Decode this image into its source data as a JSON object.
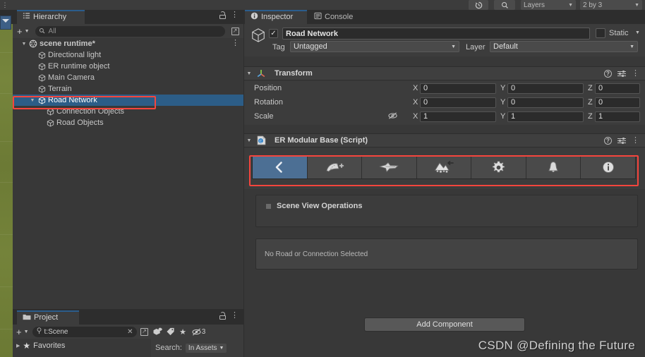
{
  "topbar": {
    "history_icon": "history-icon",
    "search_icon": "search-icon",
    "layers_label": "Layers",
    "layout_label": "2 by 3"
  },
  "hierarchy": {
    "tab_label": "Hierarchy",
    "tab_icon": "hierarchy-icon",
    "lock_icon": "lock-open-icon",
    "menu_icon": "kebab-menu-icon",
    "create_label": "+",
    "search_placeholder": "All",
    "search_icon": "search-icon",
    "expand_icon": "expand-window-icon",
    "items": [
      {
        "label": "scene runtime*",
        "depth": 0,
        "twisty": "▼",
        "icon": "unity-scene-icon",
        "selected": false,
        "kebab": true
      },
      {
        "label": "Directional light",
        "depth": 1,
        "twisty": "",
        "icon": "gameobject-cube-icon",
        "selected": false,
        "kebab": false
      },
      {
        "label": "ER runtime object",
        "depth": 1,
        "twisty": "",
        "icon": "gameobject-cube-icon",
        "selected": false,
        "kebab": false
      },
      {
        "label": "Main Camera",
        "depth": 1,
        "twisty": "",
        "icon": "gameobject-cube-icon",
        "selected": false,
        "kebab": false
      },
      {
        "label": "Terrain",
        "depth": 1,
        "twisty": "",
        "icon": "gameobject-cube-icon",
        "selected": false,
        "kebab": false
      },
      {
        "label": "Road Network",
        "depth": 1,
        "twisty": "▼",
        "icon": "gameobject-cube-icon",
        "selected": true,
        "kebab": false
      },
      {
        "label": "Connection Objects",
        "depth": 2,
        "twisty": "",
        "icon": "gameobject-cube-icon",
        "selected": false,
        "kebab": false
      },
      {
        "label": "Road Objects",
        "depth": 2,
        "twisty": "",
        "icon": "gameobject-cube-icon",
        "selected": false,
        "kebab": false
      }
    ]
  },
  "project": {
    "tab_label": "Project",
    "tab_icon": "folder-icon",
    "lock_icon": "lock-open-icon",
    "menu_icon": "kebab-menu-icon",
    "create_label": "+",
    "search_value": "t:Scene",
    "clear_icon": "clear-x-icon",
    "expand_icon": "expand-window-icon",
    "filter_type_icon": "filter-by-type-icon",
    "filter_label_icon": "filter-by-label-icon",
    "favorite_icon": "star-icon",
    "hidden_packages_icon": "hidden-packages-icon",
    "hidden_packages_count": "3",
    "favorites_label": "Favorites",
    "search_scope_label": "Search:",
    "search_scope_value": "In Assets"
  },
  "inspector": {
    "tabs": [
      {
        "label": "Inspector",
        "icon": "info-icon",
        "active": true
      },
      {
        "label": "Console",
        "icon": "console-icon",
        "active": false
      }
    ],
    "lock_icon": "lock-open-icon",
    "menu_icon": "kebab-menu-icon",
    "gameobject": {
      "icon": "gameobject-cube-icon",
      "enabled_checkmark": "✓",
      "name": "Road Network",
      "static_label": "Static",
      "tag_label": "Tag",
      "tag_value": "Untagged",
      "layer_label": "Layer",
      "layer_value": "Default"
    },
    "transform": {
      "title": "Transform",
      "icon": "transform-axes-icon",
      "help_icon": "help-icon",
      "preset_icon": "preset-icon",
      "menu_icon": "kebab-menu-icon",
      "rows": [
        {
          "label": "Position",
          "x": "0",
          "y": "0",
          "z": "0"
        },
        {
          "label": "Rotation",
          "x": "0",
          "y": "0",
          "z": "0"
        },
        {
          "label": "Scale",
          "x": "1",
          "y": "1",
          "z": "1"
        }
      ],
      "axis_x": "X",
      "axis_y": "Y",
      "axis_z": "Z",
      "constrain_icon": "constrain-proportions-off-icon"
    },
    "er_modular_base": {
      "title": "ER Modular Base (Script)",
      "icon": "csharp-script-icon",
      "help_icon": "help-icon",
      "preset_icon": "preset-icon",
      "menu_icon": "kebab-menu-icon",
      "toolbar": [
        {
          "name": "general-settings-button",
          "icon": "back-chevron-icon",
          "active": true
        },
        {
          "name": "create-road-button",
          "icon": "road-plus-icon",
          "active": false
        },
        {
          "name": "create-connection-button",
          "icon": "connection-icon",
          "active": false
        },
        {
          "name": "terrain-deform-button",
          "icon": "terrain-arrow-icon",
          "active": false
        },
        {
          "name": "settings-button",
          "icon": "gear-icon",
          "active": false
        },
        {
          "name": "import-export-button",
          "icon": "bell-icon",
          "active": false
        },
        {
          "name": "info-button",
          "icon": "info-circle-icon",
          "active": false
        }
      ],
      "scene_view_operations_label": "Scene View Operations",
      "scene_view_foldout_icon": "foldout-square-icon",
      "message": "No Road or Connection Selected"
    },
    "add_component_label": "Add Component"
  },
  "watermark": "CSDN @Defining the Future",
  "colors": {
    "selection_blue": "#2c5d87",
    "highlight_red": "#f5453d",
    "panel_bg": "#383838",
    "header_bg": "#3c3c3c",
    "tabbar_bg": "#2d2d2d",
    "active_button_blue": "#4c6f94"
  }
}
